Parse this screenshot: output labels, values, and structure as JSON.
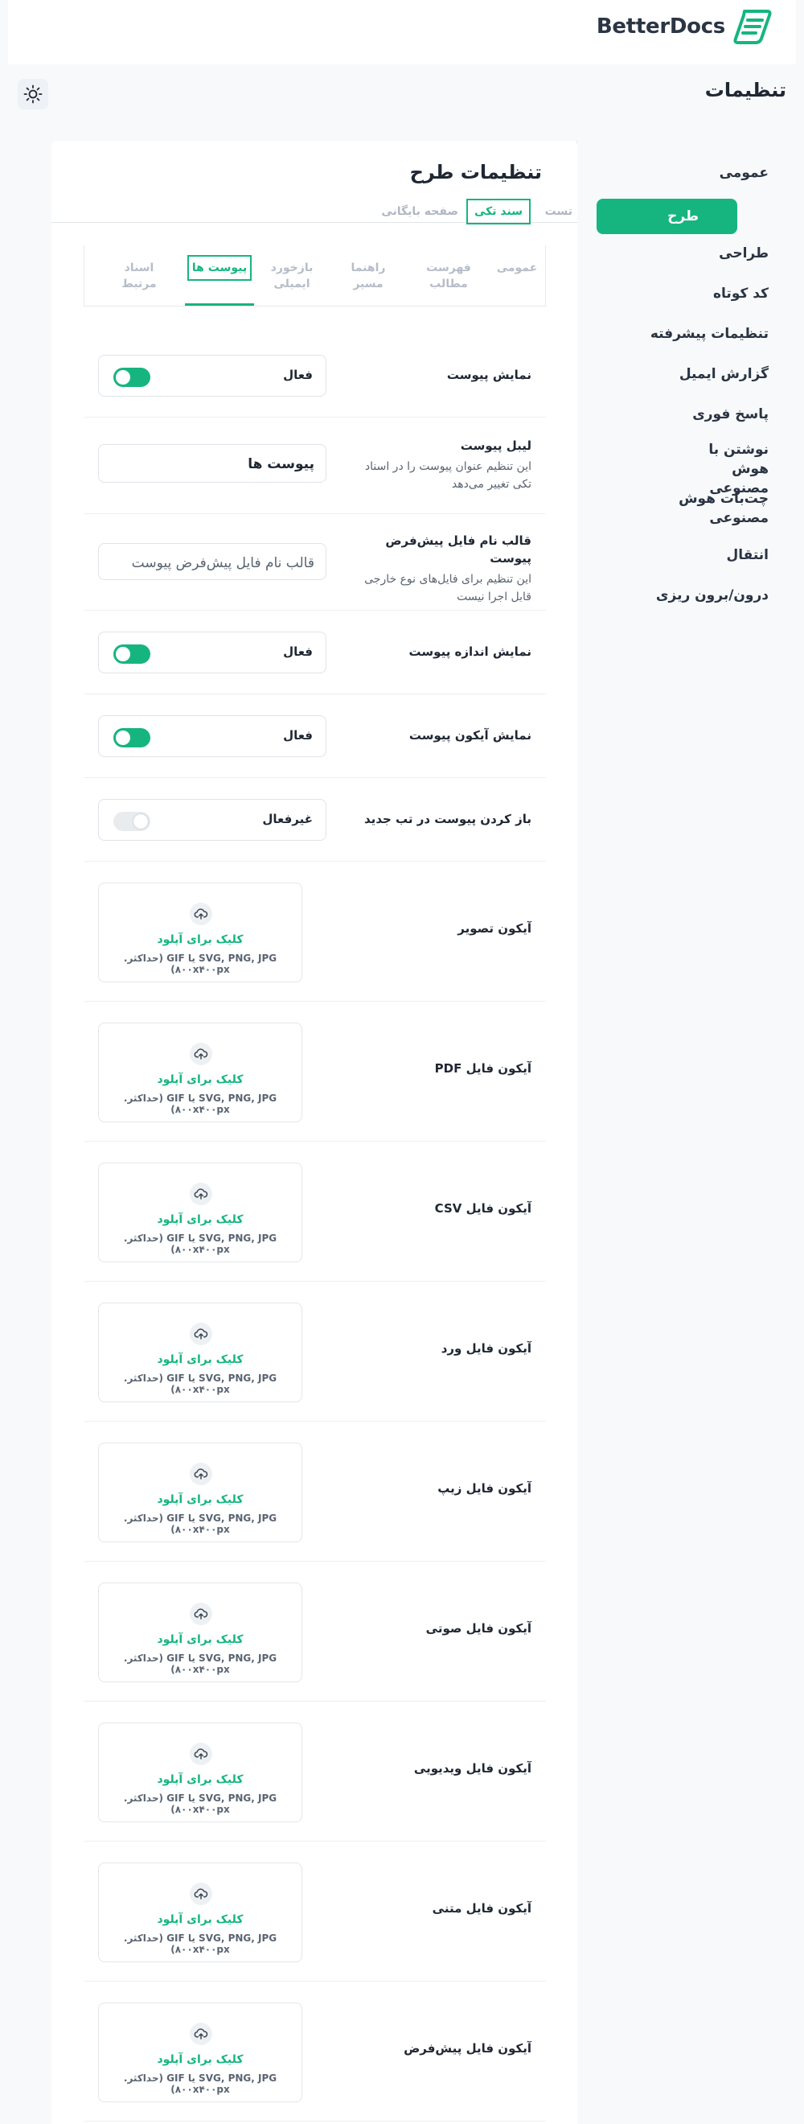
{
  "brand": {
    "name": "BetterDocs"
  },
  "page": {
    "title": "تنظیمات"
  },
  "sidebar": {
    "items": [
      {
        "label": "عمومی",
        "active": false
      },
      {
        "label": "طرح",
        "active": true
      },
      {
        "label": "طراحی",
        "active": false
      },
      {
        "label": "کد کوتاه",
        "active": false
      },
      {
        "label": "تنظیمات پیشرفته",
        "active": false
      },
      {
        "label": "گزارش ایمیل",
        "active": false
      },
      {
        "label": "پاسخ فوری",
        "active": false
      },
      {
        "label": "نوشتن با هوش مصنوعی",
        "active": false
      },
      {
        "label": "چت‌بات هوش مصنوعی",
        "active": false
      },
      {
        "label": "انتقال",
        "active": false
      },
      {
        "label": "درون/برون ریزی",
        "active": false
      }
    ]
  },
  "card": {
    "title": "تنظیمات طرح"
  },
  "tabs": [
    {
      "label": "تست",
      "active": false
    },
    {
      "label": "سند تکی",
      "active": true
    },
    {
      "label": "صفحه بایگانی",
      "active": false
    }
  ],
  "subtabs": [
    {
      "label": "عمومی",
      "active": false
    },
    {
      "label": "فهرست مطالب",
      "active": false
    },
    {
      "label": "راهنما مسیر",
      "active": false
    },
    {
      "label": "بازخورد ایمیلی",
      "active": false
    },
    {
      "label": "پیوست ها",
      "active": true
    },
    {
      "label": "اسناد مرتبط",
      "active": false
    }
  ],
  "settings": {
    "show_attachment": {
      "label": "نمایش پیوست",
      "state": "فعال",
      "on": true
    },
    "attachment_label": {
      "label": "لیبل پیوست",
      "desc": "این تنظیم عنوان پیوست را در اسناد تکی تغییر می‌دهد",
      "value": "پیوست ها"
    },
    "filename_template": {
      "label": "قالب نام فایل پیش‌فرض پیوست",
      "desc": "این تنظیم برای فایل‌های نوع خارجی قابل اجرا نیست",
      "placeholder": "قالب نام فایل پیش‌فرض پیوست"
    },
    "show_size": {
      "label": "نمایش اندازه پیوست",
      "state": "فعال",
      "on": true
    },
    "show_icon": {
      "label": "نمایش آیکون پیوست",
      "state": "فعال",
      "on": true
    },
    "open_new_tab": {
      "label": "باز کردن پیوست در تب جدید",
      "state": "غیرفعال",
      "on": false
    }
  },
  "upload": {
    "cta": "کلیک برای آپلود",
    "hint": "SVG, PNG, JPG یا GIF (حداکثر. ۸۰۰x۴۰۰px)"
  },
  "icon_rows": [
    {
      "label": "آیکون تصویر"
    },
    {
      "label": "آیکون فایل PDF"
    },
    {
      "label": "آیکون فایل CSV"
    },
    {
      "label": "آیکون فایل ورد"
    },
    {
      "label": "آیکون فایل زیپ"
    },
    {
      "label": "آیکون فایل صوتی"
    },
    {
      "label": "آیکون فایل ویدیویی"
    },
    {
      "label": "آیکون فایل متنی"
    },
    {
      "label": "آیکون فایل پیش‌فرض"
    }
  ],
  "colors": {
    "accent": "#16b57f",
    "text": "#1f2733",
    "muted": "#b0b7c2"
  }
}
